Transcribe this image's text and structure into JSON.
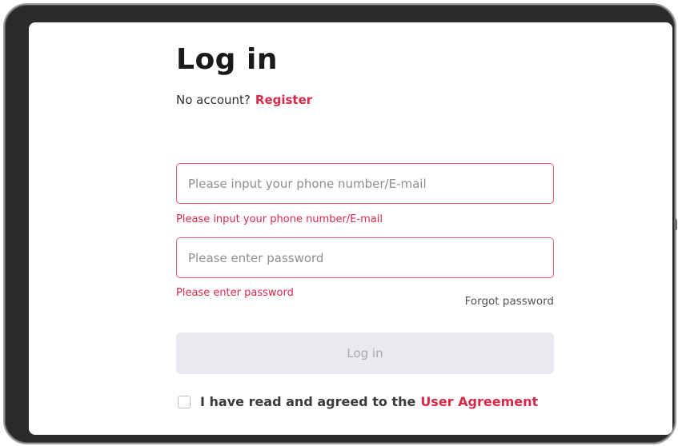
{
  "login": {
    "title": "Log in",
    "no_account_text": "No account?",
    "register_label": "Register",
    "phone_placeholder": "Please input your phone number/E-mail",
    "phone_value": "",
    "phone_error": "Please input your phone number/E-mail",
    "password_placeholder": "Please enter password",
    "password_value": "",
    "password_error": "Please enter password",
    "forgot_label": "Forgot password",
    "submit_label": "Log in",
    "agree_text": "I have read and agreed to the",
    "agreement_label": "User Agreement",
    "agree_checked": false
  },
  "colors": {
    "accent": "#d72a4a",
    "input_border": "#e0606f",
    "button_disabled_bg": "#e9e9ef",
    "button_disabled_text": "#a8a8b2",
    "device_frame": "#2b2b2d"
  }
}
